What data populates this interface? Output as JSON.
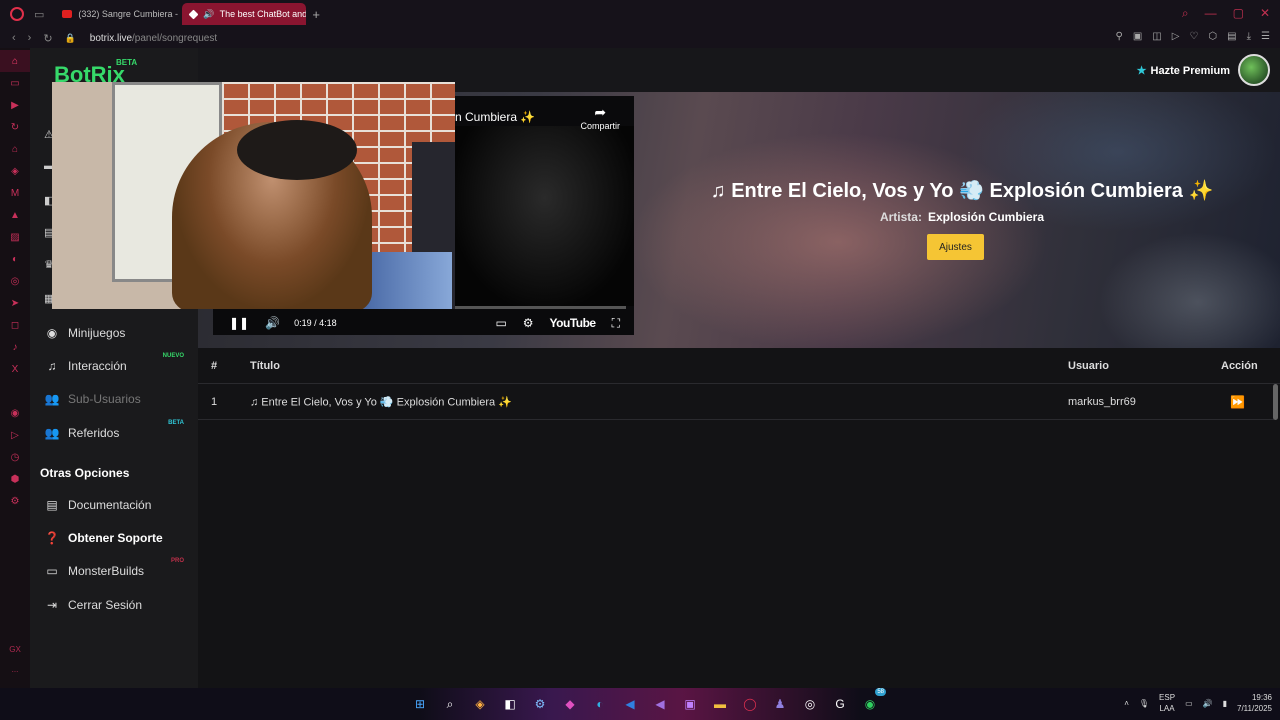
{
  "browser": {
    "tabs": [
      {
        "label": "(332) Sangre Cumbiera -"
      },
      {
        "label": "The best ChatBot and"
      }
    ],
    "new_tab": "+",
    "url_domain": "botrix.live",
    "url_path": "/panel/songrequest"
  },
  "app": {
    "logo": "BotRix",
    "logo_badge": "BETA",
    "premium_label": "Hazte Premium"
  },
  "sidebar": {
    "items": [
      {
        "label": "Minijuegos",
        "icon": "gamepad-icon",
        "badge": ""
      },
      {
        "label": "Interacción",
        "icon": "music-icon",
        "badge": "NUEVO"
      },
      {
        "label": "Sub-Usuarios",
        "icon": "users-icon",
        "badge": ""
      },
      {
        "label": "Referidos",
        "icon": "user-group-icon",
        "badge": "BETA"
      }
    ],
    "section_title": "Otras Opciones",
    "other": [
      {
        "label": "Documentación",
        "icon": "book-icon",
        "badge": ""
      },
      {
        "label": "Obtener Soporte",
        "icon": "question-icon",
        "badge": ""
      },
      {
        "label": "MonsterBuilds",
        "icon": "laptop-icon",
        "badge": "PRO"
      },
      {
        "label": "Cerrar Sesión",
        "icon": "logout-icon",
        "badge": ""
      }
    ]
  },
  "hero": {
    "song_title": "♫ Entre El Cielo, Vos y Yo 💨 Explosión Cumbiera ✨",
    "artist_label": "Artista:",
    "artist_value": "Explosión Cumbiera",
    "settings_button": "Ajustes"
  },
  "video": {
    "title": "n Cumbiera ✨",
    "share_label": "Compartir",
    "time": "0:19 / 4:18",
    "progress": 0.074,
    "brand": "YouTube"
  },
  "table": {
    "headers": {
      "num": "#",
      "title": "Título",
      "user": "Usuario",
      "action": "Acción"
    },
    "rows": [
      {
        "num": "1",
        "title": "♫ Entre El Cielo, Vos y Yo 💨 Explosión Cumbiera ✨",
        "user": "markus_brr69"
      }
    ]
  },
  "taskbar": {
    "lang_top": "ESP",
    "lang_bottom": "LAA",
    "time": "19:36",
    "date": "7/11/2025",
    "whatsapp_badge": "58"
  },
  "opera": {
    "gx_label": "GX",
    "more": "..."
  },
  "colors": {
    "accent": "#36d96a",
    "button": "#f5c534",
    "opera": "#e0304a"
  }
}
